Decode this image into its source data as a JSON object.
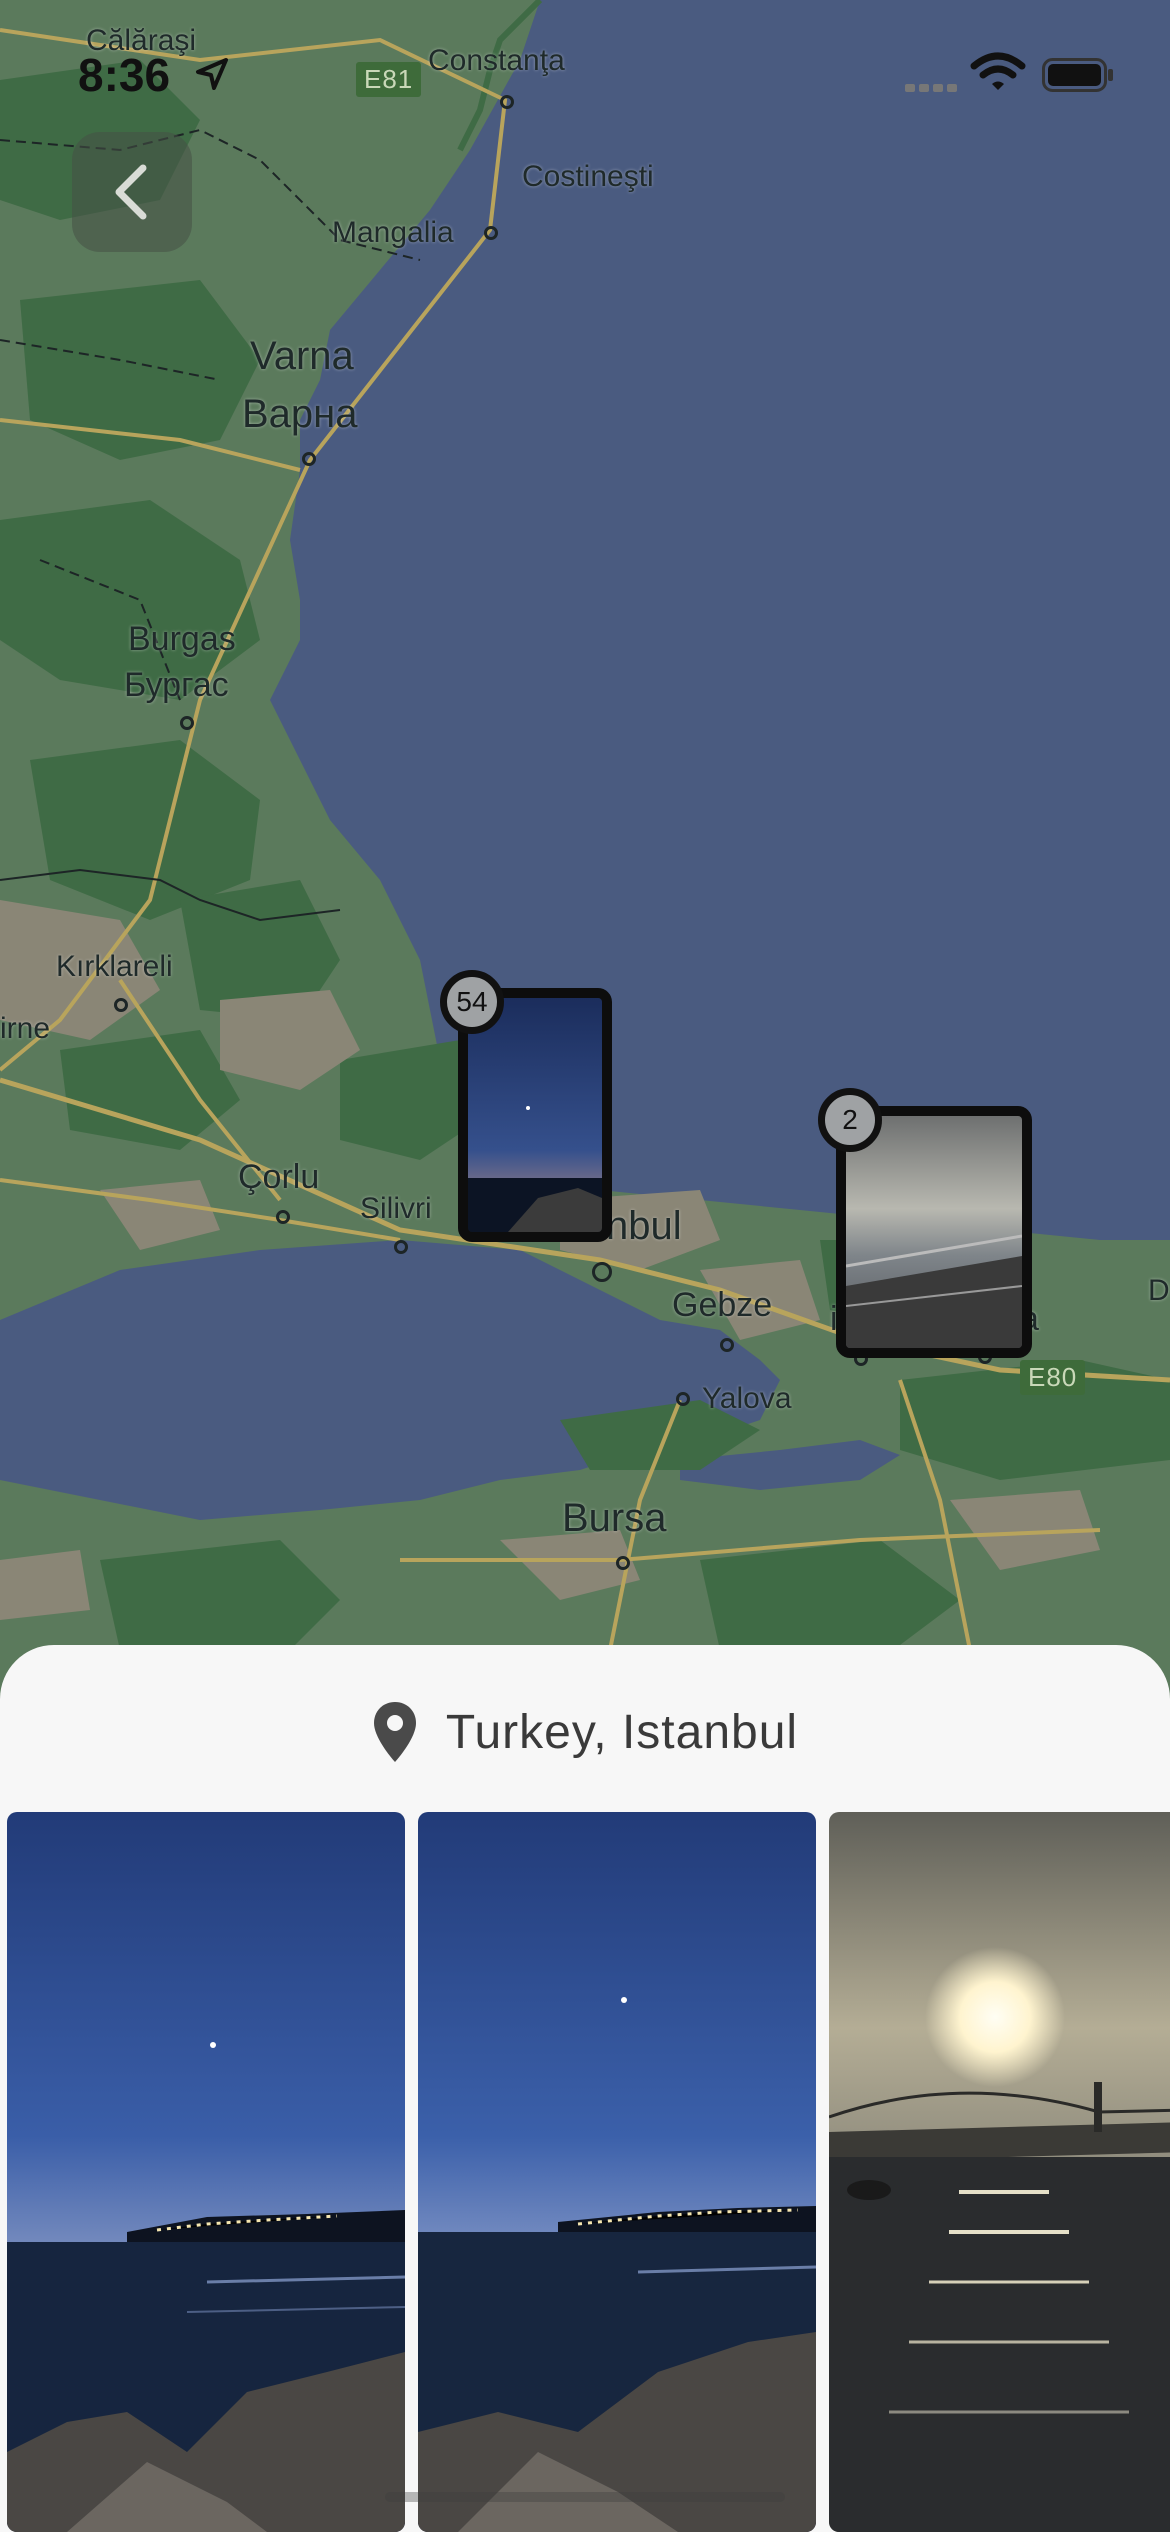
{
  "status_bar": {
    "time": "8:36",
    "icons": [
      "location-arrow-icon",
      "signal-icon",
      "wifi-icon",
      "battery-icon"
    ]
  },
  "map": {
    "labels": {
      "calarasi": "Călăraşi",
      "constanta": "Constanţa",
      "costinesti": "Costineşti",
      "mangalia": "Mangalia",
      "varna": "Varna",
      "varna_cyr": "Варна",
      "burgas": "Burgas",
      "burgas_cyr": "Бургас",
      "kirklareli": "Kırklareli",
      "edirne_partial": "irne",
      "corlu": "Çorlu",
      "silivri": "Silivri",
      "istanbul_partial": "nbul",
      "gebze": "Gebze",
      "izmit_partial": "i",
      "sapanca_partial": "a",
      "yalova": "Yalova",
      "bursa": "Bursa",
      "edge_partial": "D"
    },
    "road_badges": {
      "e81": "E81",
      "e80": "E80"
    },
    "colors": {
      "water": "#4a5b80",
      "land": "#5b7a5c",
      "forest": "#3f6b45",
      "urban": "#8a8676",
      "road": "#b8a45c"
    }
  },
  "back_button": {
    "icon": "chevron-left-icon"
  },
  "clusters": [
    {
      "count": "54",
      "thumbnail": "dusk-seaside"
    },
    {
      "count": "2",
      "thumbnail": "cloudy-pier"
    }
  ],
  "sheet": {
    "icon": "map-pin-icon",
    "title": "Turkey, Istanbul",
    "photos": [
      {
        "subject": "dusk-seaside-rocks"
      },
      {
        "subject": "dusk-seaside-rocks"
      },
      {
        "subject": "sunset-bosphorus-bridge"
      }
    ]
  }
}
